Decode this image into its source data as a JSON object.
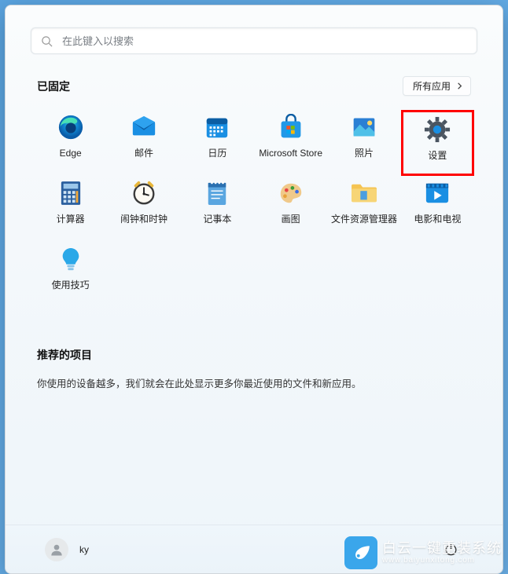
{
  "search": {
    "placeholder": "在此键入以搜索"
  },
  "pinned": {
    "title": "已固定",
    "all_apps_label": "所有应用",
    "apps": [
      {
        "name": "edge",
        "label": "Edge"
      },
      {
        "name": "mail",
        "label": "邮件"
      },
      {
        "name": "calendar",
        "label": "日历"
      },
      {
        "name": "store",
        "label": "Microsoft Store"
      },
      {
        "name": "photos",
        "label": "照片"
      },
      {
        "name": "settings",
        "label": "设置",
        "highlighted": true
      },
      {
        "name": "calculator",
        "label": "计算器"
      },
      {
        "name": "alarms",
        "label": "闹钟和时钟"
      },
      {
        "name": "notepad",
        "label": "记事本"
      },
      {
        "name": "paint",
        "label": "画图"
      },
      {
        "name": "explorer",
        "label": "文件资源管理器"
      },
      {
        "name": "movies",
        "label": "电影和电视"
      },
      {
        "name": "tips",
        "label": "使用技巧"
      }
    ]
  },
  "recommended": {
    "title": "推荐的项目",
    "description": "你使用的设备越多，我们就会在此处显示更多你最近使用的文件和新应用。"
  },
  "user": {
    "name": "ky"
  },
  "watermark": {
    "brand": "白云一键重装系统",
    "url": "www.baiyunxitong.com"
  }
}
